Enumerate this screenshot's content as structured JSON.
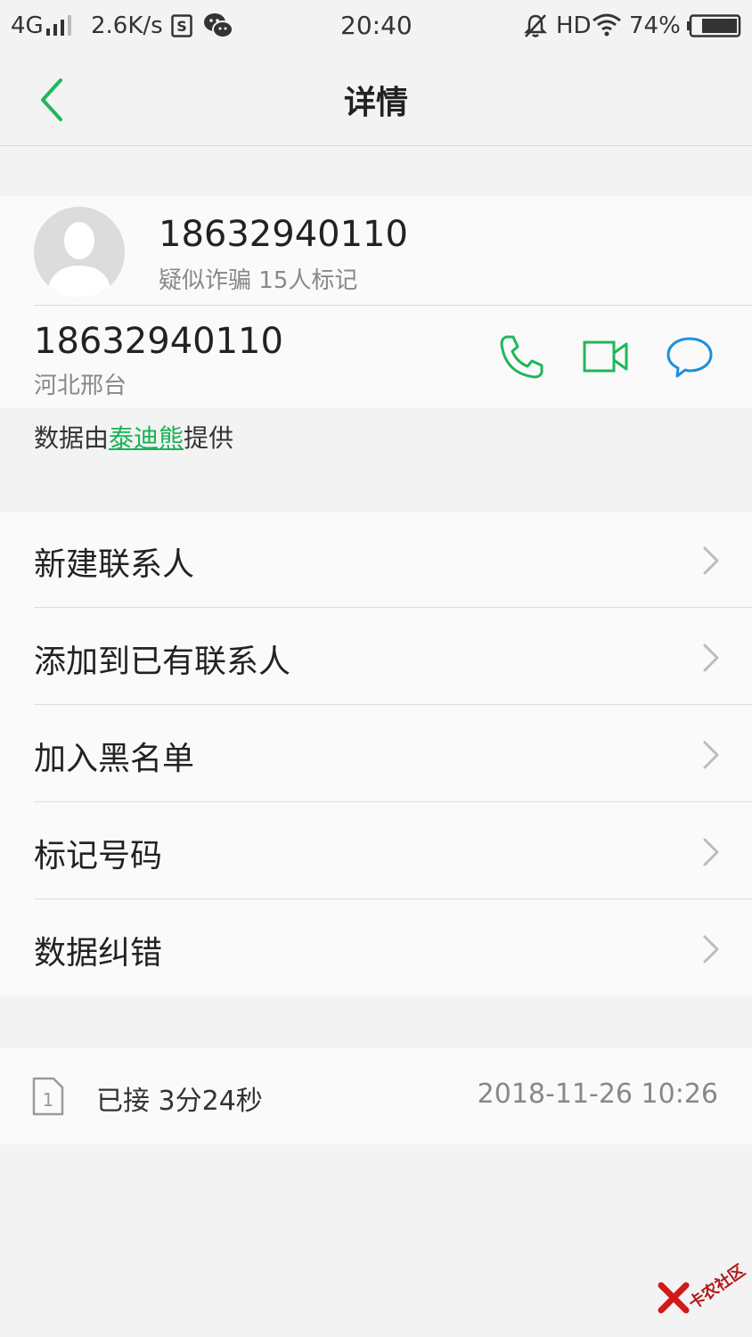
{
  "status_bar": {
    "network": "4G",
    "speed": "2.6K/s",
    "time": "20:40",
    "hd": "HD",
    "battery": "74%"
  },
  "header": {
    "title": "详情"
  },
  "contact": {
    "number": "18632940110",
    "tag_label": "疑似诈骗",
    "tag_count": "15人标记",
    "number_secondary": "18632940110",
    "location": "河北邢台"
  },
  "provider": {
    "prefix": "数据由",
    "name": "泰迪熊",
    "suffix": "提供"
  },
  "menu": {
    "items": [
      {
        "label": "新建联系人"
      },
      {
        "label": "添加到已有联系人"
      },
      {
        "label": "加入黑名单"
      },
      {
        "label": "标记号码"
      },
      {
        "label": "数据纠错"
      }
    ]
  },
  "call_log": {
    "sim": "1",
    "status": "已接",
    "duration": "3分24秒",
    "datetime": "2018-11-26 10:26"
  },
  "watermark": {
    "text": "卡农社区"
  },
  "colors": {
    "accent_green": "#1fb65a",
    "message_blue": "#1e8fe0",
    "background": "#f3f3f3"
  },
  "icons": {
    "back": "chevron-left-icon",
    "call": "phone-icon",
    "video": "video-call-icon",
    "message": "message-bubble-icon",
    "menu_arrow": "chevron-right-icon",
    "sim": "sim-card-icon"
  }
}
